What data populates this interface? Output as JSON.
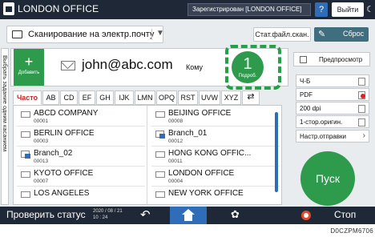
{
  "header": {
    "title": "LONDON OFFICE",
    "login_status": "Зарегистрирован [LONDON OFFICE]",
    "help_label": "?",
    "logout_label": "Выйти",
    "power_symbol": "☾"
  },
  "mode": {
    "label": "Сканирование на электр.почту",
    "dropdown_arrow": "▼"
  },
  "toolbar": {
    "status_label": "Стат.файл.скан.",
    "reset_label": "Сброс"
  },
  "destination": {
    "add_label": "Добавить",
    "add_symbol": "+",
    "email": "john@abc.com",
    "to_label": "Кому",
    "count": "1",
    "details_label": "Подроб."
  },
  "sidebar": {
    "vertical_label": "Выбрать задание одним касанием"
  },
  "tabs": [
    "Часто",
    "AB",
    "CD",
    "EF",
    "GH",
    "IJK",
    "LMN",
    "OPQ",
    "RST",
    "UVW",
    "XYZ",
    "⇄"
  ],
  "address_book": {
    "left": [
      {
        "name": "ABCD COMPANY",
        "id": "00001",
        "icon": "mail-icon"
      },
      {
        "name": "BERLIN OFFICE",
        "id": "00003",
        "icon": "mail-icon"
      },
      {
        "name": "Branch_02",
        "id": "00013",
        "icon": "group-icon"
      },
      {
        "name": "KYOTO OFFICE",
        "id": "00007",
        "icon": "mail-icon"
      },
      {
        "name": "LOS ANGELES",
        "id": "",
        "icon": "mail-icon"
      }
    ],
    "right": [
      {
        "name": "BEIJING OFFICE",
        "id": "00008",
        "icon": "mail-icon"
      },
      {
        "name": "Branch_01",
        "id": "00012",
        "icon": "group-icon"
      },
      {
        "name": "HONG KONG OFFIC...",
        "id": "00011",
        "icon": "mail-icon"
      },
      {
        "name": "LONDON OFFICE",
        "id": "00004",
        "icon": "mail-icon"
      },
      {
        "name": "NEW YORK OFFICE",
        "id": "",
        "icon": "mail-icon"
      }
    ]
  },
  "settings": {
    "preview_label": "Предпросмотр",
    "color_mode": "Ч-Б",
    "file_type": "PDF",
    "resolution": "200 dpi",
    "sides": "1-стор.оригин.",
    "send_settings": "Настр.отправки",
    "send_chevron": "›"
  },
  "start_label": "Пуск",
  "footer": {
    "status_label": "Проверить статус",
    "date": "2020 / 08 / 21",
    "time": "10 : 24",
    "back_symbol": "↶",
    "gear_symbol": "✿",
    "stop_label": "Стоп"
  },
  "figure_code": "D0CZPM6706",
  "colors": {
    "accent_green": "#2e9a4c",
    "bar_dark": "#1f2836",
    "blue": "#2f6db9",
    "reset_teal": "#3f6e7f",
    "stop_red": "#e24a2a",
    "active_tab_text": "#cc2222"
  }
}
